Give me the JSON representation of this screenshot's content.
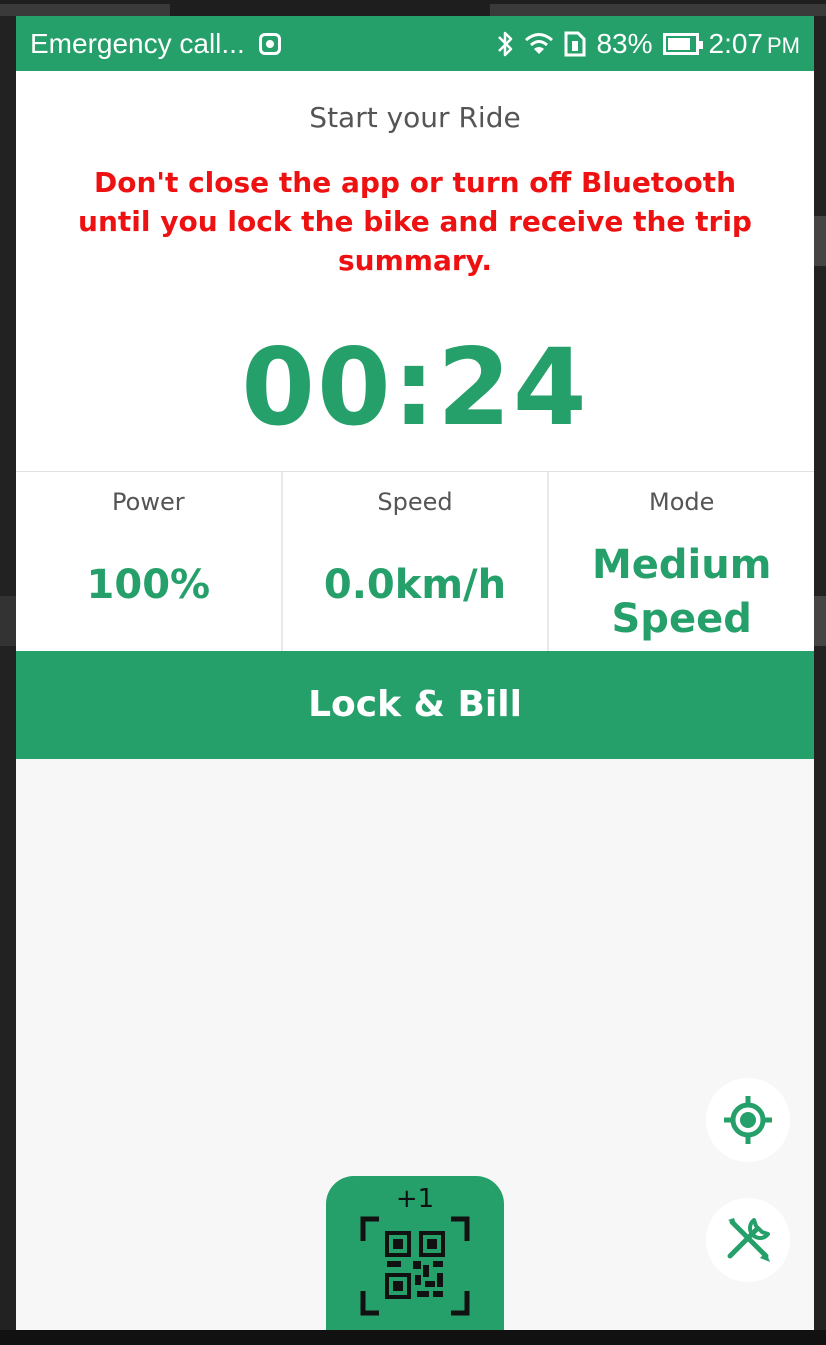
{
  "status_bar": {
    "carrier_text": "Emergency call...",
    "battery_percent": "83%",
    "battery_level": 0.83,
    "time": "2:07",
    "time_suffix": "PM",
    "icons": [
      "notification-icon",
      "bluetooth-icon",
      "wifi-icon",
      "sim-icon",
      "battery-icon"
    ]
  },
  "ride": {
    "title": "Start your Ride",
    "warning": "Don't close the app or turn off Bluetooth until you lock the bike and receive the trip summary.",
    "timer": "00:24"
  },
  "stats": {
    "power": {
      "label": "Power",
      "value": "100%"
    },
    "speed": {
      "label": "Speed",
      "value": "0.0km/h"
    },
    "mode": {
      "label": "Mode",
      "value_line1": "Medium",
      "value_line2": "Speed"
    }
  },
  "actions": {
    "lock_bill_label": "Lock & Bill",
    "scan_badge": "+1",
    "scan_icon": "qr-scan-icon",
    "locate_icon": "locate-icon",
    "tools_icon": "tools-icon"
  },
  "colors": {
    "brand_green": "#26a06a",
    "warning_red": "#ee1111"
  }
}
